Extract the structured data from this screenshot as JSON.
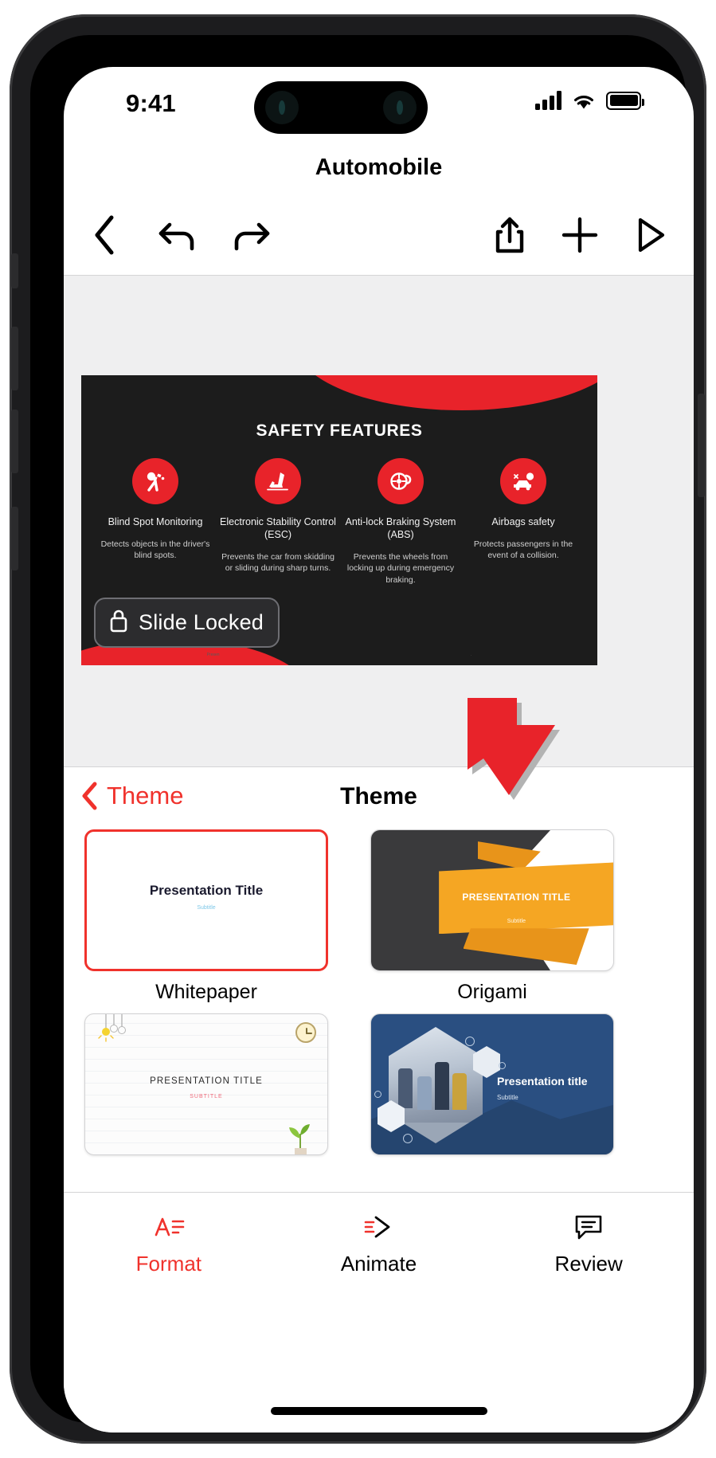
{
  "status_bar": {
    "time": "9:41",
    "signal_icon": "cellular-signal-icon",
    "wifi_icon": "wifi-icon",
    "battery_icon": "battery-icon"
  },
  "header": {
    "document_title": "Automobile"
  },
  "toolbar": {
    "back_label": "back-chevron",
    "undo_label": "undo-arrow",
    "redo_label": "redo-arrow",
    "share_label": "share-icon",
    "add_label": "plus-icon",
    "play_label": "play-icon"
  },
  "slide": {
    "title": "SAFETY FEATURES",
    "locked_badge": {
      "label": "Slide Locked",
      "icon": "lock-icon"
    },
    "features": [
      {
        "icon": "airbag-person-icon",
        "name": "Blind Spot Monitoring",
        "description": "Detects objects in the driver's blind spots."
      },
      {
        "icon": "car-seat-stability-icon",
        "name": "Electronic Stability Control (ESC)",
        "description": "Prevents the car from skidding or sliding during sharp turns."
      },
      {
        "icon": "brake-disc-icon",
        "name": "Anti-lock Braking System (ABS)",
        "description": "Prevents the wheels from locking up during emergency braking."
      },
      {
        "icon": "airbag-car-icon",
        "name": "Airbags safety",
        "description": "Protects passengers in the event of a collision."
      }
    ],
    "footer_left": "Presen",
    "footer_right": "."
  },
  "panel": {
    "back_label": "Theme",
    "title": "Theme",
    "themes": [
      {
        "name": "Whitepaper",
        "selected": true,
        "preview_title": "Presentation Title",
        "preview_subtitle": "Subtitle"
      },
      {
        "name": "Origami",
        "selected": false,
        "preview_title": "PRESENTATION TITLE",
        "preview_subtitle": "Subtitle"
      },
      {
        "name": "",
        "selected": false,
        "preview_title": "PRESENTATION TITLE",
        "preview_subtitle": "SUBTITLE"
      },
      {
        "name": "",
        "selected": false,
        "preview_title": "Presentation title",
        "preview_subtitle": "Subtitle"
      }
    ]
  },
  "tabbar": {
    "tabs": [
      {
        "label": "Format",
        "icon": "format-text-icon",
        "active": true
      },
      {
        "label": "Animate",
        "icon": "animate-arrow-icon",
        "active": false
      },
      {
        "label": "Review",
        "icon": "comment-icon",
        "active": false
      }
    ]
  },
  "annotation": {
    "pointer_icon": "red-arrow-pointer",
    "color": "#e8232a"
  },
  "colors": {
    "accent_red": "#f0322c",
    "slide_red": "#e8232a",
    "slide_bg": "#1c1c1c",
    "canvas_bg": "#efeff0"
  }
}
